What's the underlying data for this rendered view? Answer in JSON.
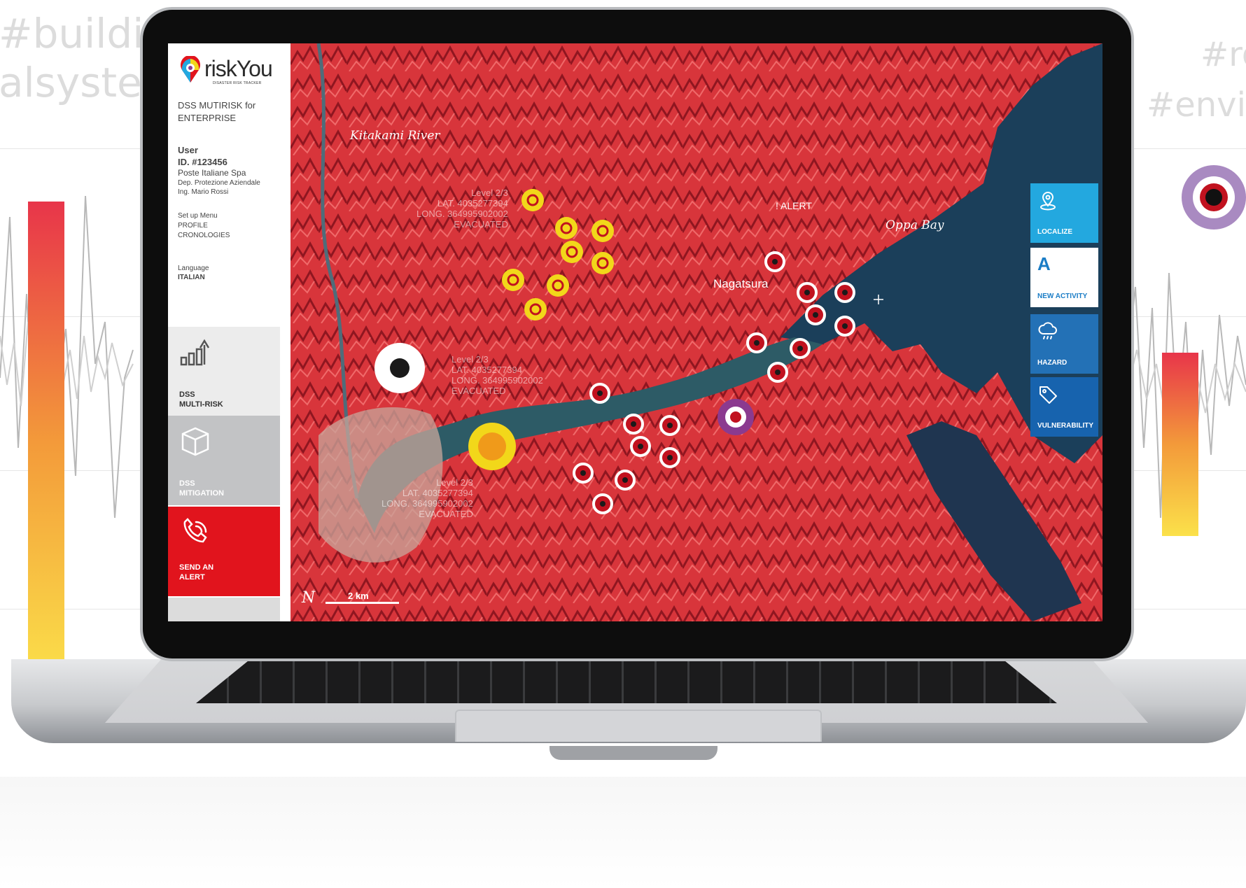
{
  "background": {
    "tags": [
      "#buildin",
      "alsyste",
      "#ro",
      "#envi"
    ]
  },
  "app": {
    "logo_name": "riskYou",
    "logo_tagline": "DISASTER RISK TRACKER",
    "product_line1": "DSS MUTIRISK for",
    "product_line2": "ENTERPRISE"
  },
  "user": {
    "label": "User",
    "id": "ID. #123456",
    "company": "Poste Italiane Spa",
    "department": "Dep. Protezione Aziendale",
    "name": "Ing. Mario Rossi"
  },
  "menu": {
    "setup": "Set up Menu",
    "profile": "PROFILE",
    "chronologies": "CRONOLOGIES",
    "language_label": "Language",
    "language_value": "ITALIAN"
  },
  "nav": {
    "dss_line1": "DSS",
    "dss_line2": "MULTI-RISK",
    "mitigation_line1": "DSS",
    "mitigation_line2": "MITIGATION",
    "alert_line1": "SEND AN",
    "alert_line2": "ALERT"
  },
  "map": {
    "river_label": "Kitakami River",
    "alert_label": "! ALERT",
    "bay_label": "Oppa Bay",
    "town_label": "Nagatsura",
    "scale_label": "2 km",
    "north_label": "N",
    "info1": {
      "level": "Level 2/3",
      "lat": "LAT. 4035277394",
      "long": "LONG. 364995902002",
      "status": "EVACUATED"
    },
    "info2": {
      "level": "Level 2/3",
      "lat": "LAT. 4035277394",
      "long": "LONG. 364995902002",
      "status": "EVACUATED"
    },
    "info3": {
      "level": "Level 2/3",
      "lat": "LAT. 4035277394",
      "long": "LONG. 364995902002",
      "status": "EVACUATED"
    }
  },
  "actions": {
    "localize": "LOCALIZE",
    "new_activity_letter": "A",
    "new_activity": "NEW ACTIVITY",
    "hazard": "HAZARD",
    "vulnerability": "VULNERABILITY"
  },
  "colors": {
    "alert_red": "#e1141d",
    "marker_yellow": "#f2d71a",
    "marker_red": "#c1121f",
    "marker_purple": "#8b3a8f",
    "marker_orange": "#f09a1a",
    "water": "#1b3f5a"
  }
}
